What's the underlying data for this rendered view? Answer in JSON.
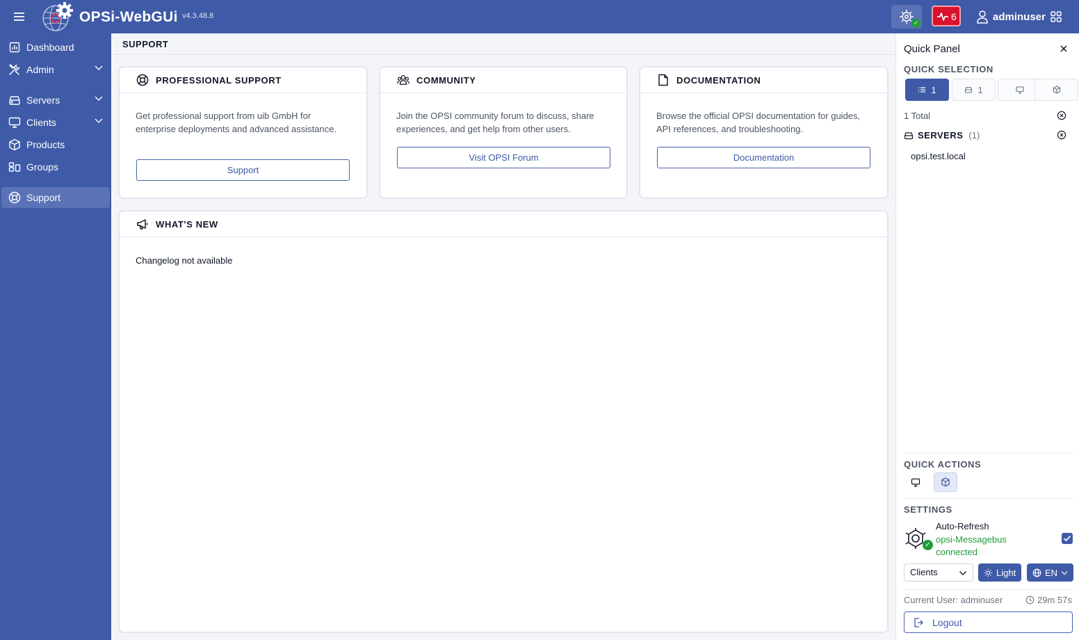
{
  "colors": {
    "brand": "#3f5aa6",
    "alert": "#d9132e",
    "success": "#1f9d3a"
  },
  "header": {
    "brand": "OPSi-WebGUi",
    "version": "v4.3.48.8",
    "alert_count": "6",
    "username": "adminuser"
  },
  "sidebar": {
    "items": [
      {
        "label": "Dashboard",
        "icon": "dashboard-icon"
      },
      {
        "label": "Admin",
        "icon": "tools-icon"
      },
      {
        "label": "Servers",
        "icon": "server-icon"
      },
      {
        "label": "Clients",
        "icon": "monitor-icon"
      },
      {
        "label": "Products",
        "icon": "package-icon"
      },
      {
        "label": "Groups",
        "icon": "groups-icon"
      },
      {
        "label": "Support",
        "icon": "lifebuoy-icon"
      }
    ]
  },
  "main": {
    "page_title": "SUPPORT",
    "cards": [
      {
        "title": "PROFESSIONAL SUPPORT",
        "description": "Get professional support from uib GmbH for enterprise deployments and advanced assistance.",
        "button": "Support"
      },
      {
        "title": "COMMUNITY",
        "description": "Join the OPSI community forum to discuss, share experiences, and get help from other users.",
        "button": "Visit OPSI Forum"
      },
      {
        "title": "DOCUMENTATION",
        "description": "Browse the official OPSI documentation for guides, API references, and troubleshooting.",
        "button": "Documentation"
      }
    ],
    "whats_new": {
      "title": "WHAT'S NEW",
      "text": "Changelog not available"
    }
  },
  "quick_panel": {
    "title": "Quick Panel",
    "quick_selection": {
      "title": "QUICK SELECTION",
      "buttons": [
        {
          "icon": "list-icon",
          "count": "1",
          "selected": true
        },
        {
          "icon": "server-icon",
          "count": "1",
          "selected": false
        },
        {
          "icon": "monitor-icon",
          "count": "",
          "selected": false
        },
        {
          "icon": "package-icon",
          "count": "",
          "selected": false
        }
      ],
      "total": "1 Total",
      "servers_label": "SERVERS",
      "servers_count": "(1)",
      "servers": [
        "opsi.test.local"
      ]
    },
    "quick_actions": {
      "title": "QUICK ACTIONS"
    },
    "settings": {
      "title": "SETTINGS",
      "auto_refresh_label": "Auto-Refresh",
      "messagebus_status": "opsi-Messagebus connected",
      "auto_refresh_checked": true,
      "view_select": "Clients",
      "theme": "Light",
      "language": "EN"
    },
    "current_user": "Current User: adminuser",
    "session_timer": "29m 57s",
    "logout": "Logout"
  }
}
